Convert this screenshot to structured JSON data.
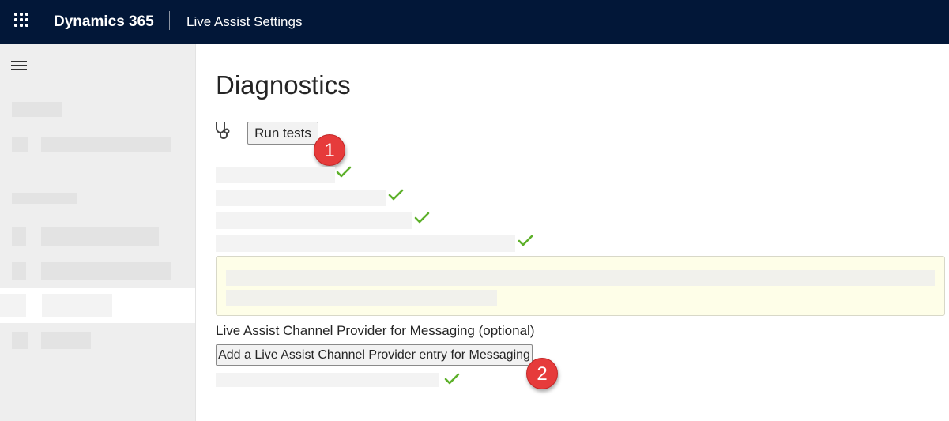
{
  "header": {
    "brand": "Dynamics 365",
    "app_title": "Live Assist Settings",
    "icons": {
      "app_launcher": "waffle-icon"
    },
    "colors": {
      "background": "#021738",
      "text": "#ffffff"
    }
  },
  "sidebar": {
    "icons": {
      "menu": "hamburger-icon"
    },
    "colors": {
      "background": "#eeeeee",
      "selected": "#ffffff"
    }
  },
  "main": {
    "title": "Diagnostics",
    "run_tests_label": "Run tests",
    "channel_section_label": "Live Assist Channel Provider for Messaging (optional)",
    "add_channel_label": "Add a Live Assist Channel Provider entry for Messaging",
    "icons": {
      "diagnostics": "stethoscope-icon",
      "status": "checkmark-icon"
    },
    "colors": {
      "check": "#5db02a",
      "warning_background": "#fefee8"
    }
  },
  "callouts": [
    {
      "number": "1",
      "color": "#e63b3b"
    },
    {
      "number": "2",
      "color": "#e63b3b"
    }
  ]
}
